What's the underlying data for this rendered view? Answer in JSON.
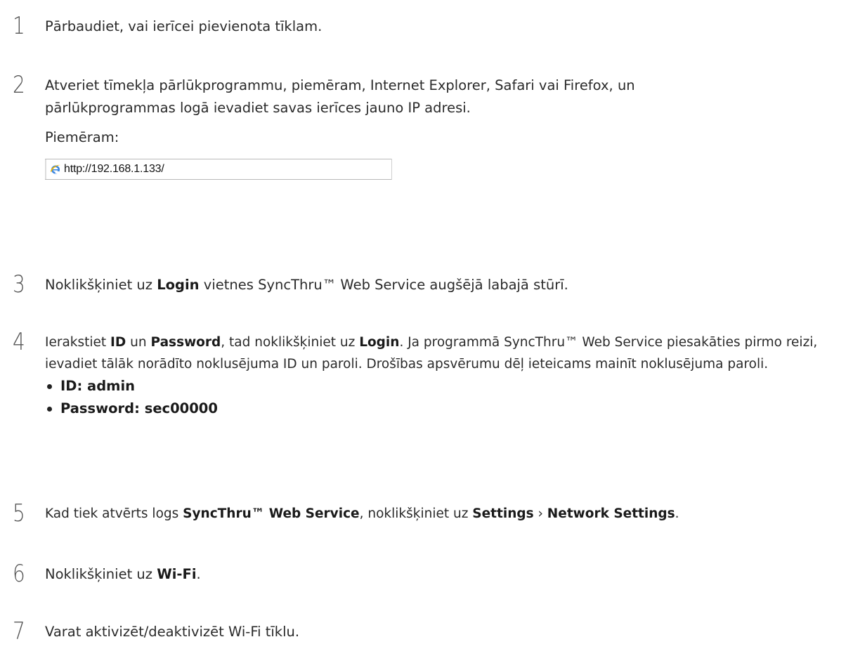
{
  "steps": [
    {
      "number": "1",
      "text": "Pārbaudiet, vai ierīcei pievienota tīklam."
    },
    {
      "number": "2",
      "line1": "Atveriet tīmekļa pārlūkprogrammu, piemēram, Internet Explorer, Safari vai Firefox, un",
      "line2": "pārlūkprogrammas logā ievadiet savas ierīces jauno IP adresi.",
      "example_label": "Piemēram:",
      "example_url": "http://192.168.1.133/"
    },
    {
      "number": "3",
      "t1": "Noklikšķiniet uz ",
      "b1": "Login",
      "t2": " vietnes SyncThru™ Web Service augšējā labajā stūrī."
    },
    {
      "number": "4",
      "t1": "Ierakstiet ",
      "b1": "ID",
      "t2": " un ",
      "b2": "Password",
      "t3": ", tad noklikšķiniet uz ",
      "b3": "Login",
      "t4": ". Ja programmā SyncThru™ Web Service piesakāties pirmo reizi, ievadiet tālāk norādīto noklusējuma ID un paroli. Drošības apsvērumu dēļ ieteicams mainīt noklusējuma paroli.",
      "bullets": [
        "ID: admin",
        "Password: sec00000"
      ]
    },
    {
      "number": "5",
      "t1": "Kad tiek atvērts logs ",
      "b1": "SyncThru™ Web Service",
      "t2": ", noklikšķiniet uz ",
      "b2": "Settings",
      "t3": " › ",
      "b3": "Network Settings",
      "t4": "."
    },
    {
      "number": "6",
      "t1": "Noklikšķiniet uz ",
      "b1": "Wi-Fi",
      "t2": "."
    },
    {
      "number": "7",
      "text": "Varat aktivizēt/deaktivizēt Wi-Fi tīklu."
    }
  ],
  "icons": {
    "browser_icon": "internet-explorer-icon"
  },
  "colors": {
    "text": "#2a2a2a",
    "step_number": "#555555",
    "ie_blue": "#2f6fd6"
  }
}
